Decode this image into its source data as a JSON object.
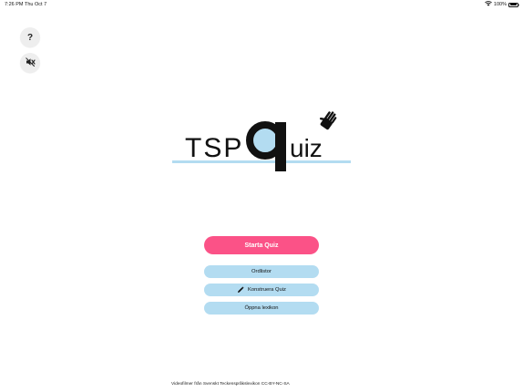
{
  "status_bar": {
    "time": "7:26 PM",
    "date": "Thu Oct 7",
    "battery_text": "100%",
    "icons": [
      "wifi-icon",
      "battery-icon"
    ]
  },
  "controls": {
    "help_label": "?",
    "mute_icon": "speaker-muted-icon"
  },
  "logo": {
    "tsp": "TSP",
    "q": "q",
    "uiz": "uiz",
    "icon": "hand-icon",
    "colors": {
      "text": "#111111",
      "q_fill": "#b3dcf1",
      "underline": "#b3dcf1"
    }
  },
  "menu": {
    "start_label": "Starta Quiz",
    "ordlistor_label": "Ordlistor",
    "konstruera_label": "Konstruera Quiz",
    "konstruera_icon": "pencil-icon",
    "oppna_label": "Öppna lexikon"
  },
  "footer": {
    "credit": "Videofilmer från Svenskt Teckenspråkslexikon CC-BY-NC-SA"
  },
  "colors": {
    "primary": "#fb5287",
    "secondary": "#b3dcf1",
    "control_bg": "#eeeeee"
  }
}
